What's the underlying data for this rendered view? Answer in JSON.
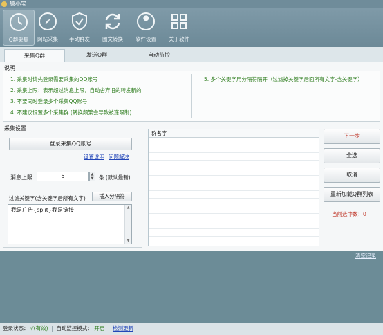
{
  "window": {
    "title": "猿小宝"
  },
  "toolbar": {
    "items": [
      {
        "label": "Q群采集",
        "icon": "clock-icon"
      },
      {
        "label": "网站采集",
        "icon": "compass-icon"
      },
      {
        "label": "手动群发",
        "icon": "shield-icon"
      },
      {
        "label": "图文转换",
        "icon": "sync-icon"
      },
      {
        "label": "软件设置",
        "icon": "wrench-icon"
      },
      {
        "label": "关于软件",
        "icon": "grid-icon"
      }
    ],
    "active_index": 0
  },
  "tabs": [
    {
      "label": "采集Q群"
    },
    {
      "label": "发送Q群"
    },
    {
      "label": "自动监控"
    }
  ],
  "instructions": {
    "title": "说明",
    "left_items": [
      "1. 采集时请先登录需要采集的QQ账号",
      "2. 采集上限：表示超过消息上限，自动舍弃旧的转发新的",
      "3. 不要同时登录多个采集QQ账号",
      "4. 不建议设置多个采集群 (转换频繁会导致被冻限制)"
    ],
    "right_items": [
      "5. 多个关键字用分隔符隔开（过滤掉关键字后面所有文字-含关键字）"
    ]
  },
  "collect": {
    "title": "采集设置",
    "login_button": "登录采集QQ账号",
    "link_setup": "设置说明",
    "link_feedback": "问题解决",
    "limit_label": "消息上限",
    "limit_value": "5",
    "limit_unit": "条 (默认最新)",
    "filter_label": "过滤关键字(含关键字后所有文字)",
    "insert_button": "插入分隔符",
    "filter_text": "我是广告{split}我是链接"
  },
  "grid": {
    "header": "群名字",
    "rows": []
  },
  "actions": {
    "next": "下一步",
    "select_all": "全选",
    "cancel": "取消",
    "reload": "重新加载Q群列表",
    "selected_count": "当前选中数：0"
  },
  "log": {
    "clear": "清空记录"
  },
  "status": {
    "login_label": "登录状态：",
    "login_value": "√(有效)",
    "auto_label": "自动监控模式：",
    "auto_value": "开启",
    "update_link": "检测更新"
  },
  "colors": {
    "accent_green": "#2e7d1e",
    "accent_red": "#c0392b",
    "link_blue": "#2246b8",
    "toolbar_bg": "#7f9aa8",
    "log_bg": "#6c8c97"
  }
}
